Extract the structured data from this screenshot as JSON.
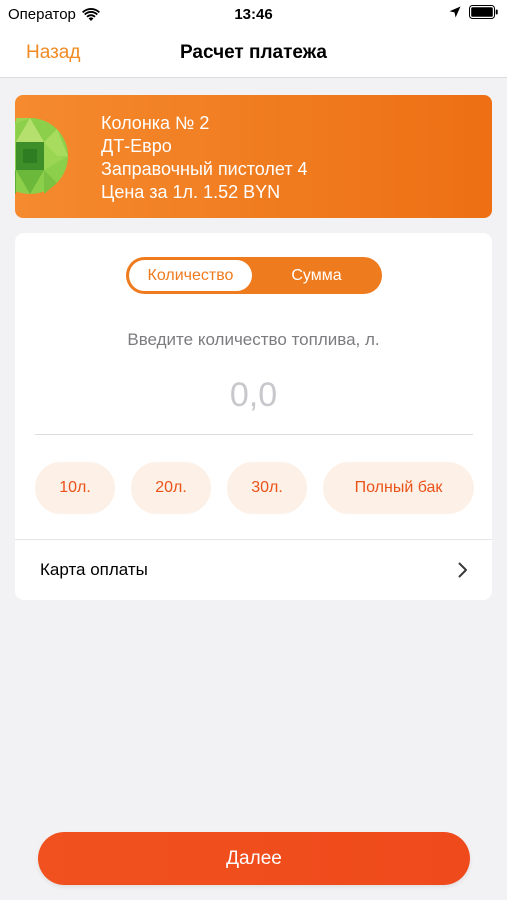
{
  "status_bar": {
    "carrier": "Оператор",
    "time": "13:46"
  },
  "nav": {
    "back_label": "Назад",
    "title": "Расчет платежа"
  },
  "station": {
    "column": "Колонка № 2",
    "fuel": "ДТ-Евро",
    "nozzle": "Заправочный пистолет 4",
    "price": "Цена за 1л. 1.52 BYN"
  },
  "mode_toggle": {
    "options": [
      "Количество",
      "Сумма"
    ],
    "selected": "Количество"
  },
  "amount": {
    "prompt": "Введите количество топлива, л.",
    "placeholder": "0,0",
    "value": ""
  },
  "presets": [
    "10л.",
    "20л.",
    "30л.",
    "Полный бак"
  ],
  "payment_card": {
    "label": "Карта оплаты"
  },
  "next_button": {
    "label": "Далее"
  },
  "colors": {
    "accent": "#f07a1e",
    "button": "#ef4a1c",
    "chip_bg": "#fdf0e6",
    "chip_text": "#e9531a",
    "logo_green": "#7cc242"
  }
}
